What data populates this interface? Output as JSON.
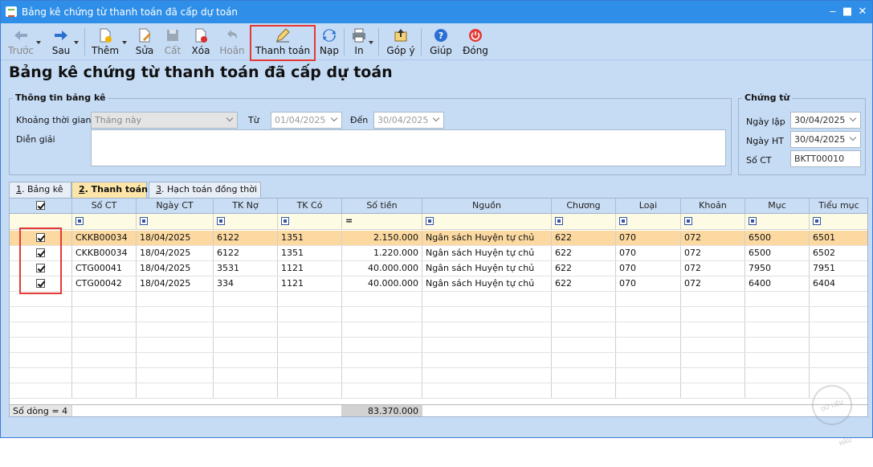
{
  "window": {
    "title": "Bảng kê chứng từ thanh toán đã cấp dự toán",
    "minimize": "‒",
    "maximize": "■",
    "close": "✕"
  },
  "toolbar": {
    "prev": "Trước",
    "next": "Sau",
    "add": "Thêm",
    "edit": "Sửa",
    "save": "Cất",
    "delete": "Xóa",
    "undo": "Hoãn",
    "pay": "Thanh toán",
    "reload": "Nạp",
    "print": "In",
    "feedback": "Góp ý",
    "help": "Giúp",
    "close": "Đóng"
  },
  "page_title": "Bảng kê chứng từ thanh toán đã cấp dự toán",
  "info": {
    "legend": "Thông tin bảng kê",
    "period_label": "Khoảng thời gian",
    "period_value": "Tháng này",
    "from_label": "Từ",
    "from_value": "01/04/2025",
    "to_label": "Đến",
    "to_value": "30/04/2025",
    "desc_label": "Diễn giải",
    "desc_value": ""
  },
  "voucher": {
    "legend": "Chứng từ",
    "date_label": "Ngày lập",
    "date_value": "30/04/2025",
    "post_label": "Ngày HT",
    "post_value": "30/04/2025",
    "no_label": "Số CT",
    "no_value": "BKTT00010"
  },
  "tabs": [
    {
      "num": "1",
      "label": ". Bảng kê"
    },
    {
      "num": "2",
      "label": ". Thanh toán"
    },
    {
      "num": "3",
      "label": ". Hạch toán đồng thời"
    }
  ],
  "grid": {
    "columns": [
      "Số CT",
      "Ngày CT",
      "TK Nợ",
      "TK Có",
      "Số tiền",
      "Nguồn",
      "Chương",
      "Loại",
      "Khoản",
      "Mục",
      "Tiểu mục"
    ],
    "amount_filter": "=",
    "rows": [
      [
        "CKKB00034",
        "18/04/2025",
        "6122",
        "1351",
        "2.150.000",
        "Ngân sách Huyện tự chủ",
        "622",
        "070",
        "072",
        "6500",
        "6501"
      ],
      [
        "CKKB00034",
        "18/04/2025",
        "6122",
        "1351",
        "1.220.000",
        "Ngân sách Huyện tự chủ",
        "622",
        "070",
        "072",
        "6500",
        "6502"
      ],
      [
        "CTG00041",
        "18/04/2025",
        "3531",
        "1121",
        "40.000.000",
        "Ngân sách Huyện tự chủ",
        "622",
        "070",
        "072",
        "7950",
        "7951"
      ],
      [
        "CTG00042",
        "18/04/2025",
        "334",
        "1121",
        "40.000.000",
        "Ngân sách Huyện tự chủ",
        "622",
        "070",
        "072",
        "6400",
        "6404"
      ]
    ],
    "footer_count": "Số dòng = 4",
    "footer_total": "83.370.000"
  },
  "watermark": "DỮ LIỆU MẪU",
  "colors": {
    "accent": "#2f8fe8",
    "highlight": "#e53935",
    "selected_row": "#fcd9a0"
  }
}
